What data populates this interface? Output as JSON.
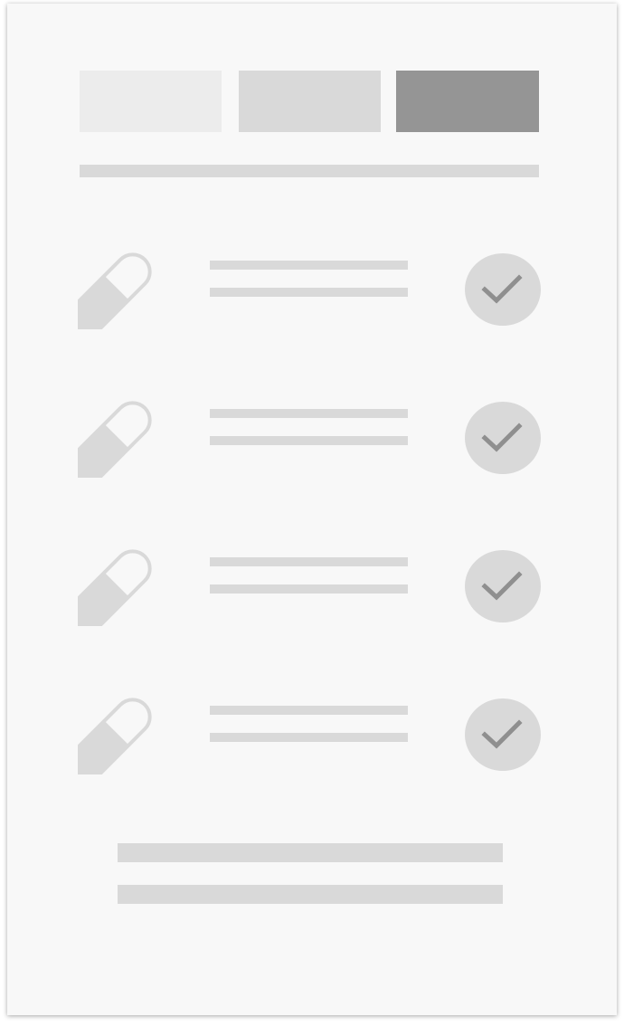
{
  "colors": {
    "card_bg": "#f8f8f8",
    "placeholder": "#d9d9d9",
    "tab_inactive_1": "#ececec",
    "tab_inactive_2": "#d9d9d9",
    "tab_active": "#959595",
    "icon_dark": "#8f8f8f",
    "pill_fill": "#d9d9d9"
  },
  "tabs": [
    {
      "state": "inactive"
    },
    {
      "state": "inactive"
    },
    {
      "state": "active"
    }
  ],
  "medications": [
    {
      "icon": "pill-icon",
      "status_icon": "check-icon",
      "checked": true
    },
    {
      "icon": "pill-icon",
      "status_icon": "check-icon",
      "checked": true
    },
    {
      "icon": "pill-icon",
      "status_icon": "check-icon",
      "checked": true
    },
    {
      "icon": "pill-icon",
      "status_icon": "check-icon",
      "checked": true
    }
  ]
}
